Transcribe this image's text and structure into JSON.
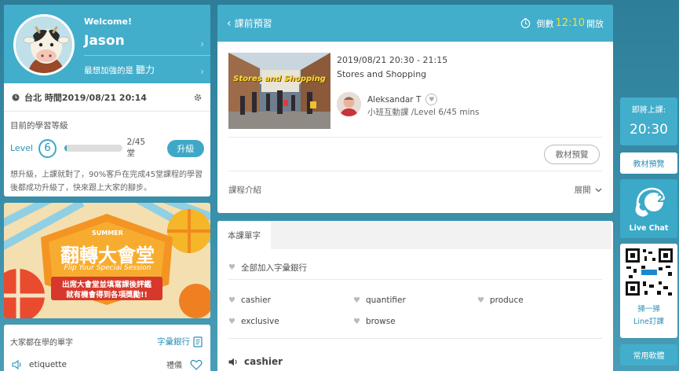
{
  "profile": {
    "welcome": "Welcome!",
    "name": "Jason",
    "focus_prefix": "最想加強的是",
    "focus_skill": "聽力",
    "time_text": "台北 時間2019/08/21 20:14"
  },
  "level": {
    "title": "目前的學習等級",
    "label": "Level",
    "number": "6",
    "progress_text": "2/45 堂",
    "progress_fraction": 0.044,
    "upgrade_label": "升級",
    "note": "想升級，上課就對了，90%客戶在完成45堂課程的學習後都成功升級了，快來跟上大家的腳步。"
  },
  "promo": {
    "summer": "SUMMER",
    "title": "翻轉大會堂",
    "subtitle": "Flip Your Special Session",
    "line1": "出席大會堂並填寫課後評鑑",
    "line2": "就有機會得到各項獎勵!!"
  },
  "popular_vocab": {
    "title": "大家都在學的單字",
    "bank_label": "字彙銀行",
    "items": [
      {
        "word": "etiquette",
        "meaning": "禮儀"
      }
    ]
  },
  "class": {
    "header_title": "課前預習",
    "countdown_prefix": "倒數",
    "countdown_time": "12:10",
    "countdown_suffix": "開放",
    "image_caption": "Stores and Shopping",
    "time": "2019/08/21 20:30 - 21:15",
    "topic": "Stores and Shopping",
    "teacher": "Aleksandar T",
    "lesson_type": "小班互動課 /Level 6/45 mins",
    "preview_label": "教材預覽",
    "intro_label": "課程介紹",
    "expand_label": "展開"
  },
  "words": {
    "tab_label": "本課單字",
    "add_all": "全部加入字彙銀行",
    "list": [
      "cashier",
      "quantifier",
      "produce",
      "exclusive",
      "browse"
    ],
    "featured": "cashier"
  },
  "sidebar": {
    "soon_label": "即將上課:",
    "soon_time": "20:30",
    "prep_label": "教材預覽",
    "live_number": "24",
    "live_label": "Live Chat",
    "qr_line1": "掃一掃",
    "qr_line2": "Line訂課",
    "common_label": "常用軟體"
  },
  "colors": {
    "accent": "#42aecb",
    "accent_text": "#2a90b8",
    "countdown": "#f5e12c",
    "background": "#2f7c97"
  }
}
